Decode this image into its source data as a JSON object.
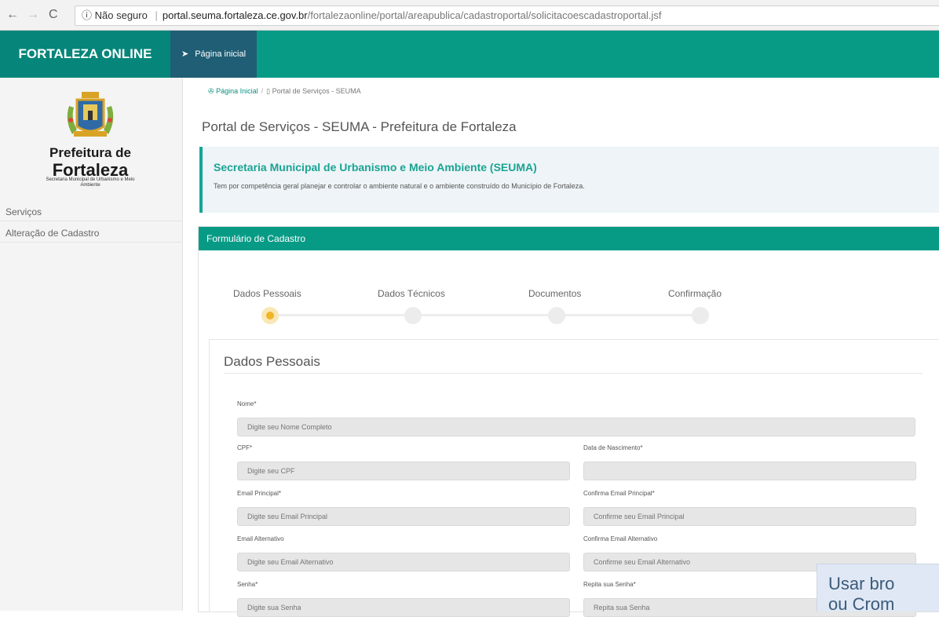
{
  "browser": {
    "security_label": "Não seguro",
    "url_host": "portal.seuma.fortaleza.ce.gov.br",
    "url_path": "/fortalezaonline/portal/areapublica/cadastroportal/solicitacoescadastroportal.jsf"
  },
  "topbar": {
    "brand": "FORTALEZA ONLINE",
    "tab": "Página inicial"
  },
  "sidebar": {
    "logo_line1": "Prefeitura de",
    "logo_line2": "Fortaleza",
    "logo_line3": "Secretaria Municipal de Urbanismo e Meio Ambiente",
    "items": [
      {
        "label": "Serviços"
      },
      {
        "label": "Alteração de Cadastro"
      }
    ]
  },
  "breadcrumb": {
    "home": "Página Inicial",
    "current": "Portal de Serviços - SEUMA"
  },
  "page_title": "Portal de Serviços - SEUMA - Prefeitura de Fortaleza",
  "callout": {
    "title": "Secretaria Municipal de Urbanismo e Meio Ambiente (SEUMA)",
    "text": "Tem por competência geral planejar e controlar o ambiente natural e o ambiente construído do Município de Fortaleza."
  },
  "form": {
    "panel_title": "Formulário de Cadastro",
    "steps": [
      "Dados Pessoais",
      "Dados Técnicos",
      "Documentos",
      "Confirmação"
    ],
    "active_step": 0,
    "section_title": "Dados Pessoais",
    "fields": {
      "nome": {
        "label": "Nome*",
        "placeholder": "Digite seu Nome Completo"
      },
      "cpf": {
        "label": "CPF*",
        "placeholder": "Digite seu CPF"
      },
      "nascimento": {
        "label": "Data de Nascimento*",
        "placeholder": ""
      },
      "email": {
        "label": "Email Principal*",
        "placeholder": "Digite seu Email Principal"
      },
      "email_conf": {
        "label": "Confirma Email Principal*",
        "placeholder": "Confirme seu Email Principal"
      },
      "email_alt": {
        "label": "Email Alternativo",
        "placeholder": "Digite seu Email Alternativo"
      },
      "email_alt_conf": {
        "label": "Confirma Email Alternativo",
        "placeholder": "Confirme seu Email Alternativo"
      },
      "senha": {
        "label": "Senha*",
        "placeholder": "Digite sua Senha"
      },
      "senha_conf": {
        "label": "Repita sua Senha*",
        "placeholder": "Repita sua Senha"
      }
    }
  },
  "overlay_note": "Usar bro ou Crom",
  "colors": {
    "teal": "#079b86",
    "tab_dark": "#1f5e74",
    "step_active": "#f0b429"
  }
}
